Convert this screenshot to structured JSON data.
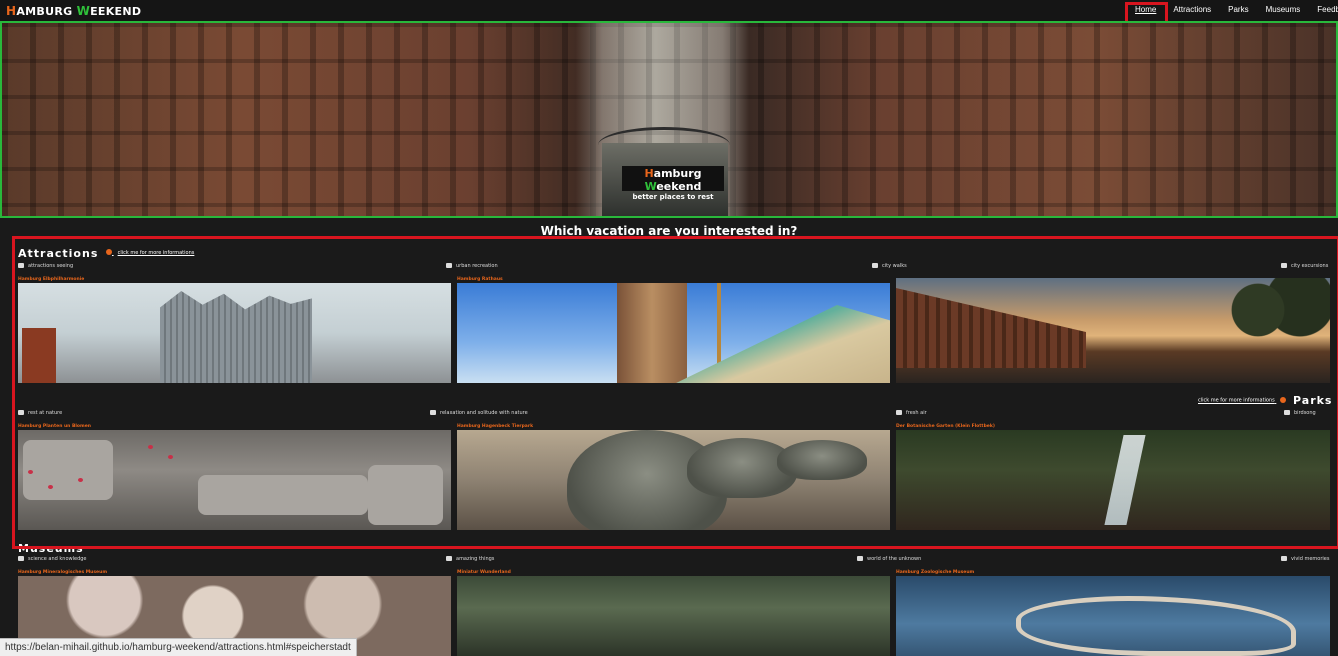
{
  "nav": {
    "brand": {
      "h": "H",
      "rest1": "AMBURG ",
      "w": "W",
      "rest2": "EEKEND"
    },
    "links": [
      "Home",
      "Attractions",
      "Parks",
      "Museums",
      "Feedback"
    ]
  },
  "hero": {
    "title_h": "H",
    "title_rest1": "amburg ",
    "title_w": "W",
    "title_rest2": "eekend",
    "subtitle": "better places to rest"
  },
  "question": "Which vacation are you interested in?",
  "attractions": {
    "title": "Attractions",
    "more": "click me for more informations",
    "items": [
      {
        "category": "attractions seeing",
        "place": "Hamburg Elbphilharmonie"
      },
      {
        "category": "urban recreation",
        "place": "Hamburg Rathaus"
      },
      {
        "category": "city walks",
        "place": ""
      },
      {
        "category": "city excursions",
        "place": ""
      }
    ]
  },
  "parks": {
    "title": "Parks",
    "more": "click me for more informations",
    "items": [
      {
        "category": "rest at nature",
        "place": "Hamburg Planten un Blomen"
      },
      {
        "category": "relaxation and solitude with nature",
        "place": "Hamburg Hagenbeck Tierpark"
      },
      {
        "category": "fresh air",
        "place": "Der Botanische Garten (Klein Flottbek)"
      },
      {
        "category": "birdsong",
        "place": ""
      }
    ]
  },
  "museums": {
    "title": "Museums",
    "items": [
      {
        "category": "science and knowledge",
        "place": "Hamburg Mineralogisches Museum"
      },
      {
        "category": "amazing things",
        "place": "Miniatur Wunderland"
      },
      {
        "category": "world of the unknown",
        "place": "Hamburg Zoologische Museum"
      },
      {
        "category": "vivid memories",
        "place": ""
      }
    ]
  },
  "status_url": "https://belan-mihail.github.io/hamburg-weekend/attractions.html#speicherstadt"
}
